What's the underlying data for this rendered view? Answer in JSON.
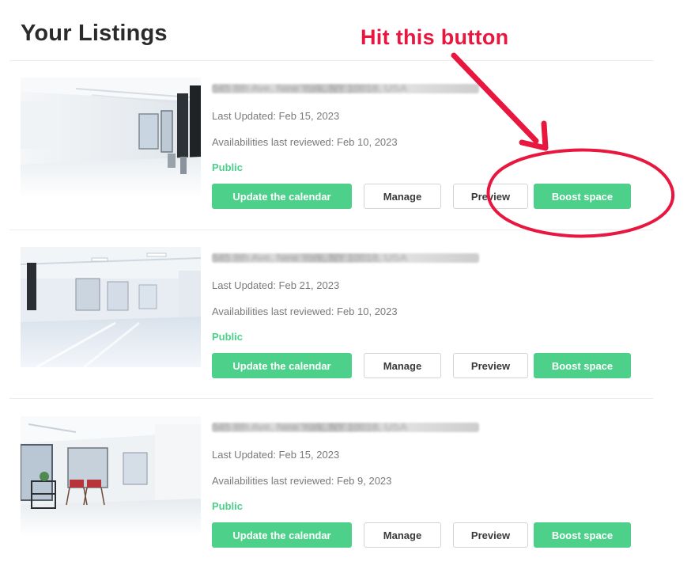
{
  "page": {
    "title": "Your Listings"
  },
  "annotation": {
    "text": "Hit this button",
    "color": "#e8173f"
  },
  "colors": {
    "accent": "#4cd08a",
    "annotation": "#e8173f"
  },
  "buttons": {
    "calendar": "Update the calendar",
    "manage": "Manage",
    "preview": "Preview",
    "boost": "Boost space"
  },
  "listings": [
    {
      "address": "545 8th Ave, New York, NY 10018, USA",
      "last_updated": "Last Updated: Feb 15, 2023",
      "reviewed": "Availabilities last reviewed: Feb 10, 2023",
      "status": "Public"
    },
    {
      "address": "545 8th Ave, New York, NY 10018, USA",
      "last_updated": "Last Updated: Feb 21, 2023",
      "reviewed": "Availabilities last reviewed: Feb 10, 2023",
      "status": "Public"
    },
    {
      "address": "545 8th Ave, New York, NY 10018, USA",
      "last_updated": "Last Updated: Feb 15, 2023",
      "reviewed": "Availabilities last reviewed: Feb 9, 2023",
      "status": "Public"
    }
  ]
}
